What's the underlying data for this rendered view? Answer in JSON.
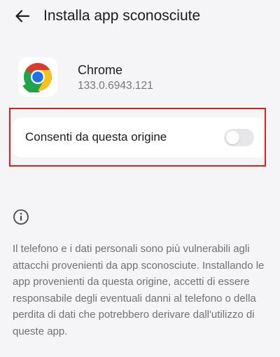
{
  "header": {
    "title": "Installa app sconosciute",
    "back_icon": "arrow-left-icon"
  },
  "app": {
    "name": "Chrome",
    "version": "133.0.6943.121",
    "icon": "chrome-icon"
  },
  "setting": {
    "label": "Consenti da questa origine",
    "enabled": false
  },
  "info": {
    "icon": "info-icon",
    "text": "Il telefono e i dati personali sono più vulnerabili agli attacchi provenienti da app sconosciute. Installando le app provenienti da questa origine, accetti di essere responsabile degli eventuali danni al telefono o della perdita di dati che potrebbero derivare dall'utilizzo di queste app."
  },
  "colors": {
    "background": "#f5f5f7",
    "card": "#ffffff",
    "highlight": "#d6201f",
    "switch_off": "#e7e7ea",
    "secondary_text": "#707075"
  }
}
